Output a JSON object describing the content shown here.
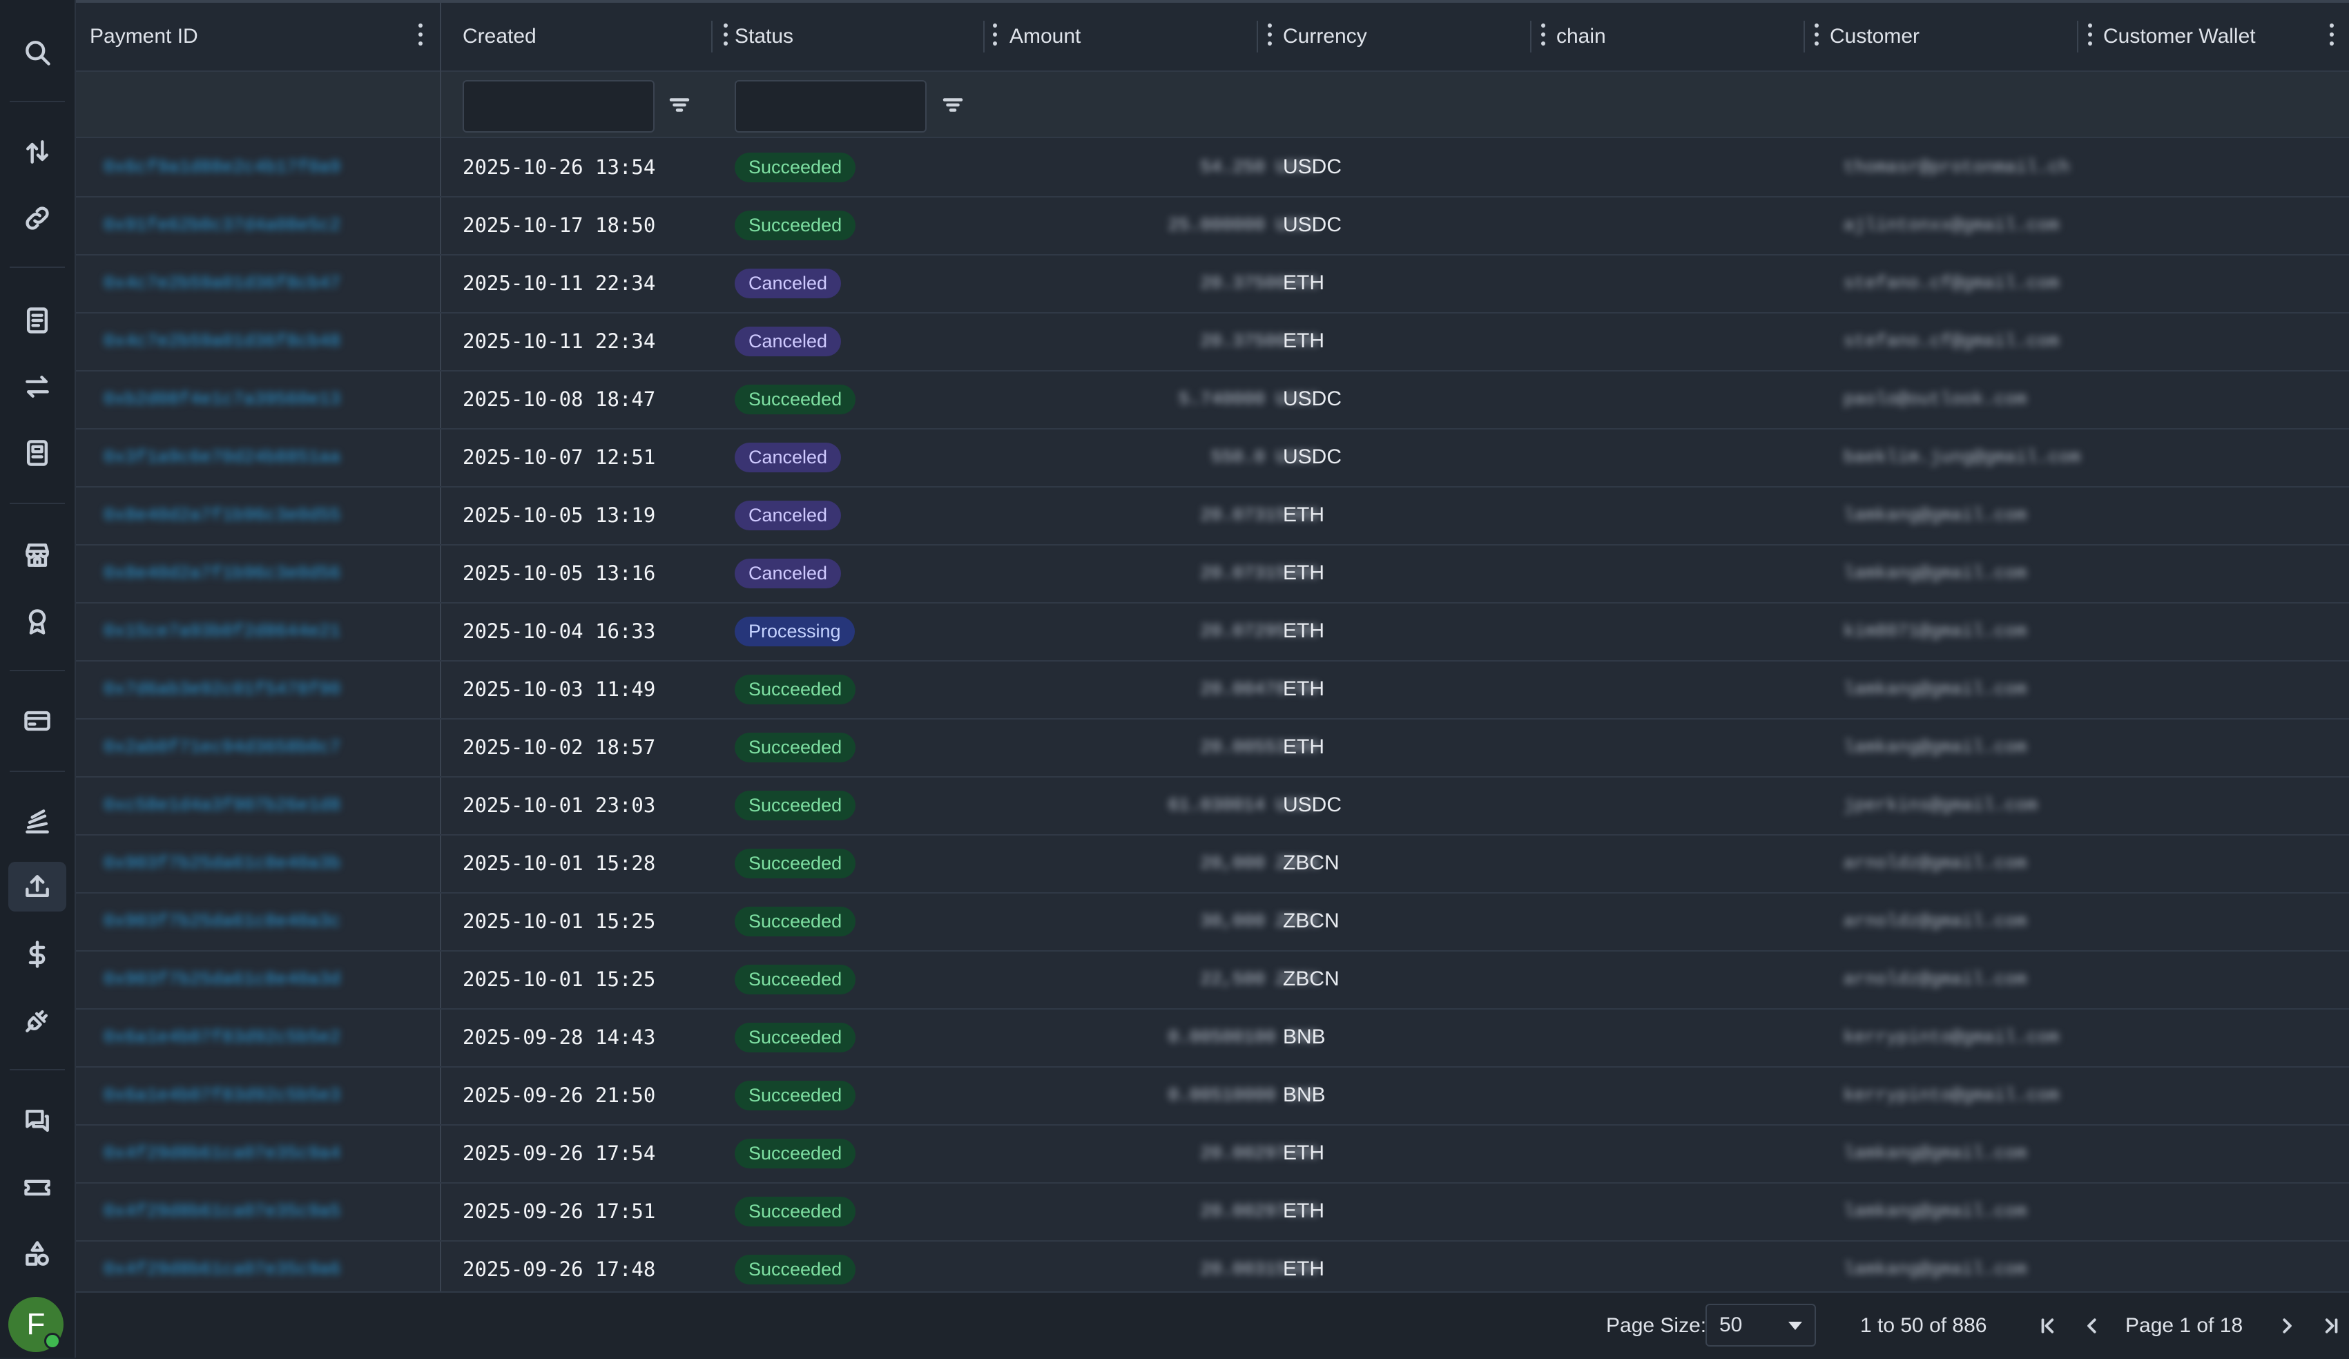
{
  "columns": [
    {
      "label": "Payment ID"
    },
    {
      "label": "Created"
    },
    {
      "label": "Status"
    },
    {
      "label": "Amount"
    },
    {
      "label": "Currency"
    },
    {
      "label": "chain"
    },
    {
      "label": "Customer"
    },
    {
      "label": "Customer Wallet"
    }
  ],
  "rows": [
    {
      "pid": "0x6cf9a1d88e2c4b17f0a9",
      "created": "2025-10-26 13:54",
      "status": "Succeeded",
      "amount": "54.250 USDC",
      "currency": "USDC",
      "customer": "thomasr@protonmail.ch"
    },
    {
      "pid": "0x91fe62b0c37d4a08e5c2",
      "created": "2025-10-17 18:50",
      "status": "Succeeded",
      "amount": "25.000000 USDC",
      "currency": "USDC",
      "customer": "ajlintonxx@gmail.com"
    },
    {
      "pid": "0x4c7e2b59a01d36f8cb47",
      "created": "2025-10-11 22:34",
      "status": "Canceled",
      "amount": "20.37500000",
      "currency": "ETH",
      "customer": "stefano.cf@gmail.com"
    },
    {
      "pid": "0x4c7e2b59a01d36f8cb48",
      "created": "2025-10-11 22:34",
      "status": "Canceled",
      "amount": "20.37500000",
      "currency": "ETH",
      "customer": "stefano.cf@gmail.com"
    },
    {
      "pid": "0xb2d08f4e1c7a39560e13",
      "created": "2025-10-08 18:47",
      "status": "Succeeded",
      "amount": "5.740000 USDC",
      "currency": "USDC",
      "customer": "paolo@outlook.com"
    },
    {
      "pid": "0x3f1a9c6e70d24b8851aa",
      "created": "2025-10-07 12:51",
      "status": "Canceled",
      "amount": "550.0 USDC",
      "currency": "USDC",
      "customer": "baeklim.jung@gmail.com"
    },
    {
      "pid": "0x8e40d2a7f1b96c3e0d55",
      "created": "2025-10-05 13:19",
      "status": "Canceled",
      "amount": "20.07315000",
      "currency": "ETH",
      "customer": "lamkang@gmail.com"
    },
    {
      "pid": "0x8e40d2a7f1b96c3e0d56",
      "created": "2025-10-05 13:16",
      "status": "Canceled",
      "amount": "20.07315000",
      "currency": "ETH",
      "customer": "lamkang@gmail.com"
    },
    {
      "pid": "0x15ce7a93b0f2d8644e21",
      "created": "2025-10-04 16:33",
      "status": "Processing",
      "amount": "20.07295300",
      "currency": "ETH",
      "customer": "kim8071@gmail.com"
    },
    {
      "pid": "0x7d6ab3e92c01f5478f90",
      "created": "2025-10-03 11:49",
      "status": "Succeeded",
      "amount": "20.00478700",
      "currency": "ETH",
      "customer": "lamkang@gmail.com"
    },
    {
      "pid": "0x2ab0f71ec94d3658b0c7",
      "created": "2025-10-02 18:57",
      "status": "Succeeded",
      "amount": "20.00553300",
      "currency": "ETH",
      "customer": "lamkang@gmail.com"
    },
    {
      "pid": "0xc58e1d4a3f907b26e1d8",
      "created": "2025-10-01 23:03",
      "status": "Succeeded",
      "amount": "61.030014 USDC",
      "currency": "USDC",
      "customer": "jperkins@gmail.com"
    },
    {
      "pid": "0x903f7b25da61c8e40a3b",
      "created": "2025-10-01 15:28",
      "status": "Succeeded",
      "amount": "20,000 ZBCN",
      "currency": "ZBCN",
      "customer": "arnoldz@gmail.com"
    },
    {
      "pid": "0x903f7b25da61c8e40a3c",
      "created": "2025-10-01 15:25",
      "status": "Succeeded",
      "amount": "30,000 ZBCN",
      "currency": "ZBCN",
      "customer": "arnoldz@gmail.com"
    },
    {
      "pid": "0x903f7b25da61c8e40a3d",
      "created": "2025-10-01 15:25",
      "status": "Succeeded",
      "amount": "22,500 ZBCN",
      "currency": "ZBCN",
      "customer": "arnoldz@gmail.com"
    },
    {
      "pid": "0x6a1e4b07f83d92c5b5e2",
      "created": "2025-09-28 14:43",
      "status": "Succeeded",
      "amount": "0.00500100 BNB",
      "currency": "BNB",
      "customer": "kerrypinto@gmail.com"
    },
    {
      "pid": "0x6a1e4b07f83d92c5b5e3",
      "created": "2025-09-26 21:50",
      "status": "Succeeded",
      "amount": "0.00510000 BNB",
      "currency": "BNB",
      "customer": "kerrypinto@gmail.com"
    },
    {
      "pid": "0x4f29d8b61ca07e35c9a4",
      "created": "2025-09-26 17:54",
      "status": "Succeeded",
      "amount": "20.00297000",
      "currency": "ETH",
      "customer": "lamkang@gmail.com"
    },
    {
      "pid": "0x4f29d8b61ca07e35c9a5",
      "created": "2025-09-26 17:51",
      "status": "Succeeded",
      "amount": "20.00297000",
      "currency": "ETH",
      "customer": "lamkang@gmail.com"
    },
    {
      "pid": "0x4f29d8b61ca07e35c9a6",
      "created": "2025-09-26 17:48",
      "status": "Succeeded",
      "amount": "20.00315000",
      "currency": "ETH",
      "customer": "lamkang@gmail.com"
    }
  ],
  "pager": {
    "page_size_label": "Page Size:",
    "page_size_value": "50",
    "range_text": "1 to 50 of 886",
    "page_text": "Page 1 of 18"
  },
  "user": {
    "avatar_initial": "F"
  },
  "colors": {
    "succeeded": "#13452b",
    "canceled": "#3a3472",
    "processing": "#26367a",
    "link": "#2a9ad8"
  },
  "sidebar_icons": [
    "search-icon",
    "transfer-arrows-icon",
    "link-icon",
    "invoice-icon",
    "swap-icon",
    "report-icon",
    "store-icon",
    "badge-icon",
    "card-icon",
    "stack-icon",
    "upload-icon",
    "dollar-icon",
    "plugin-icon",
    "chat-icon",
    "ticket-icon",
    "shapes-icon"
  ]
}
